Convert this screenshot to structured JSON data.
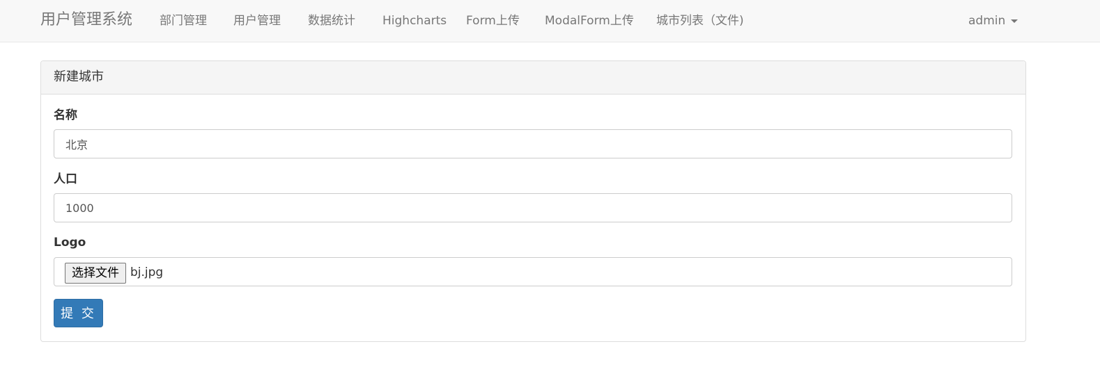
{
  "navbar": {
    "brand": "用户管理系统",
    "links": [
      "部门管理",
      "用户管理",
      "数据统计",
      "Highcharts",
      "Form上传",
      "ModalForm上传",
      "城市列表（文件)"
    ],
    "user": "admin"
  },
  "panel": {
    "title": "新建城市",
    "fields": {
      "name": {
        "label": "名称",
        "value": "北京"
      },
      "population": {
        "label": "人口",
        "value": "1000"
      },
      "logo": {
        "label": "Logo",
        "button": "选择文件",
        "filename": "bj.jpg"
      }
    },
    "submit": "提 交"
  },
  "colors": {
    "primary": "#337ab7",
    "navbar_bg": "#f8f8f8",
    "panel_heading_bg": "#f5f5f5"
  }
}
